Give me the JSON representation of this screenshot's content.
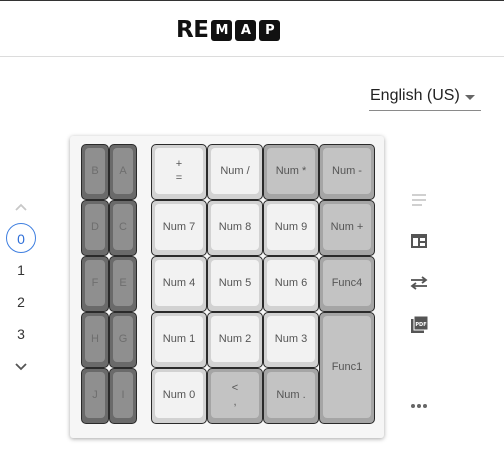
{
  "header": {
    "logo_re": "RE",
    "logo_boxes": [
      "M",
      "A",
      "P"
    ]
  },
  "language": {
    "selected": "English (US)"
  },
  "layers": {
    "items": [
      "0",
      "1",
      "2",
      "3"
    ],
    "active": "0"
  },
  "keyboard": {
    "keys": [
      {
        "label": "B",
        "style": "dark"
      },
      {
        "label": "A",
        "style": "dark"
      },
      {
        "label": "D",
        "style": "dark"
      },
      {
        "label": "C",
        "style": "dark"
      },
      {
        "label": "F",
        "style": "dark"
      },
      {
        "label": "E",
        "style": "dark"
      },
      {
        "label": "H",
        "style": "dark"
      },
      {
        "label": "G",
        "style": "dark"
      },
      {
        "label": "J",
        "style": "dark"
      },
      {
        "label": "I",
        "style": "dark"
      },
      {
        "label": "+\n=",
        "style": "light"
      },
      {
        "label": "Num /",
        "style": "light"
      },
      {
        "label": "Num *",
        "style": "mid"
      },
      {
        "label": "Num -",
        "style": "mid"
      },
      {
        "label": "Num 7",
        "style": "light"
      },
      {
        "label": "Num 8",
        "style": "light"
      },
      {
        "label": "Num 9",
        "style": "light"
      },
      {
        "label": "Num +",
        "style": "mid"
      },
      {
        "label": "Num 4",
        "style": "light"
      },
      {
        "label": "Num 5",
        "style": "light"
      },
      {
        "label": "Num 6",
        "style": "light"
      },
      {
        "label": "Func4",
        "style": "mid"
      },
      {
        "label": "Num 1",
        "style": "light"
      },
      {
        "label": "Num 2",
        "style": "light"
      },
      {
        "label": "Num 3",
        "style": "light"
      },
      {
        "label": "Func1",
        "style": "mid"
      },
      {
        "label": "Num 0",
        "style": "light"
      },
      {
        "label": "<\n,",
        "style": "mid"
      },
      {
        "label": "Num .",
        "style": "mid"
      }
    ]
  },
  "sidebar_icons": [
    "notes-icon",
    "layout-icon",
    "swap-icon",
    "pdf-icon",
    "more-icon"
  ],
  "colors": {
    "accent": "#2f6fd8"
  }
}
